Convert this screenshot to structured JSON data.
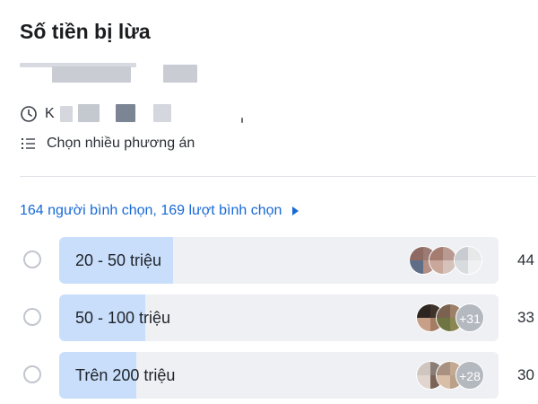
{
  "poll": {
    "title": "Số tiền bị lừa",
    "meta_deadline_prefix": "K",
    "meta_type": "Chọn nhiều phương án",
    "summary": "164 người bình chọn, 169 lượt bình chọn"
  },
  "options": [
    {
      "label": "20 - 50 triệu",
      "count": "44",
      "fraction": 0.26,
      "more": ""
    },
    {
      "label": "50 - 100 triệu",
      "count": "33",
      "fraction": 0.195,
      "more": "+31"
    },
    {
      "label": "Trên 200 triệu",
      "count": "30",
      "fraction": 0.175,
      "more": "+28"
    }
  ],
  "colors": {
    "accent": "#1769d6",
    "bar_fill": "#c9defa",
    "bar_track": "#eef0f3",
    "divider": "#dfe2e7"
  },
  "icons": {
    "deadline": "clock-icon",
    "poll_type": "list-icon",
    "expand": "caret-right-icon"
  }
}
